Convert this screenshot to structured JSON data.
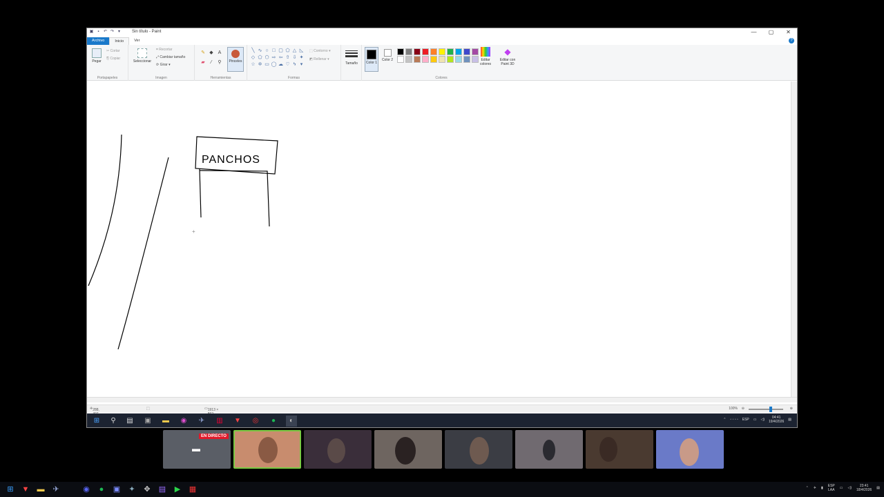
{
  "window": {
    "title": "Sin título - Paint",
    "controls": [
      "—",
      "▢",
      "✕"
    ]
  },
  "menu": {
    "file": "Archivo",
    "home": "Inicio",
    "view": "Ver"
  },
  "ribbon": {
    "clipboard": {
      "paste": "Pegar",
      "cut": "Cortar",
      "copy": "Copiar",
      "group": "Portapapeles"
    },
    "image": {
      "select": "Seleccionar",
      "crop": "Recortar",
      "resize": "Cambiar tamaño",
      "rotate": "Girar",
      "group": "Imagen"
    },
    "tools": {
      "brushes": "Pinceles",
      "group": "Herramientas"
    },
    "shapes": {
      "outline": "Contorno",
      "fill": "Rellenar",
      "group": "Formas"
    },
    "size": {
      "label": "Tamaño"
    },
    "colors": {
      "color1": "Color 1",
      "color2": "Color 2",
      "edit": "Editar colores",
      "paint3d": "Editar con Paint 3D",
      "group": "Colores",
      "palette": [
        "#000000",
        "#7f7f7f",
        "#880015",
        "#ed1c24",
        "#ff7f27",
        "#fff200",
        "#22b14c",
        "#00a2e8",
        "#3f48cc",
        "#a349a4",
        "#ffffff",
        "#c3c3c3",
        "#b97a57",
        "#ffaec9",
        "#ffc90e",
        "#efe4b0",
        "#b5e61d",
        "#99d9ea",
        "#7092be",
        "#c8bfe7"
      ]
    }
  },
  "canvas": {
    "sign_text": "PANCHOS"
  },
  "status": {
    "cursor": "288, 407 píxeles",
    "size": "1913 × 862 píxeles",
    "zoom": "100%"
  },
  "inner_taskbar": {
    "lang": "ESP",
    "time": "04:41",
    "date": "19/4/2026"
  },
  "thumbnails": {
    "live_label": "EN DIRECTO",
    "count": 8
  },
  "os_taskbar": {
    "lang_top": "ESP",
    "lang_bottom": "LAA",
    "time": "23:41",
    "date": "18/4/2026"
  }
}
